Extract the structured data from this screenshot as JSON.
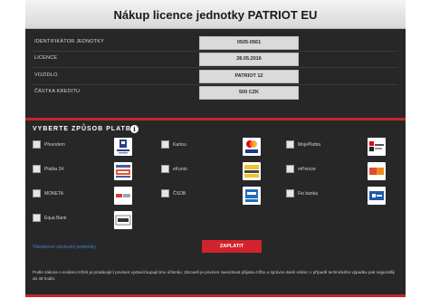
{
  "header": {
    "title": "Nákup licence jednotky PATRIOT EU"
  },
  "details": [
    {
      "label": "IDENTIFIKÁTOR JEDNOTKY",
      "value": "0505-0561"
    },
    {
      "label": "LICENCE",
      "value": "28.05.2016"
    },
    {
      "label": "VOZIDLO",
      "value": "PATRIOT 12"
    },
    {
      "label": "ČÁSTKA KREDITU",
      "value": "500 CZK"
    }
  ],
  "payment": {
    "title": "VYBERTE ZPŮSOB PLATBY",
    "methods": [
      {
        "label": "Převodem",
        "logo": "raiffeisen-logo"
      },
      {
        "label": "Kartou",
        "logo": "mastercard-visa-logo"
      },
      {
        "label": "MojePlatba",
        "logo": "komercni-banka-logo"
      },
      {
        "label": "Platba 24",
        "logo": "csob-platba-logo"
      },
      {
        "label": "eKonto",
        "logo": "ekonto-logo"
      },
      {
        "label": "mPeníze",
        "logo": "mpenize-logo"
      },
      {
        "label": "MONETA",
        "logo": "moneta-logo"
      },
      {
        "label": "ČSOB",
        "logo": "csob-logo"
      },
      {
        "label": "Fio banka",
        "logo": "fio-logo"
      },
      {
        "label": "Equa Bank",
        "logo": "equa-logo"
      }
    ]
  },
  "actions": {
    "link": "Všeobecné obchodní podmínky",
    "pay_label": "ZAPLATIT"
  },
  "note": "Podle zákona o evidenci tržeb je prodávající povinen vystavit kupujícímu účtenku. Zároveň je povinen zaevidovat přijatou tržbu u správce daně online; v případě technického výpadku pak nejpozději do 48 hodin."
}
